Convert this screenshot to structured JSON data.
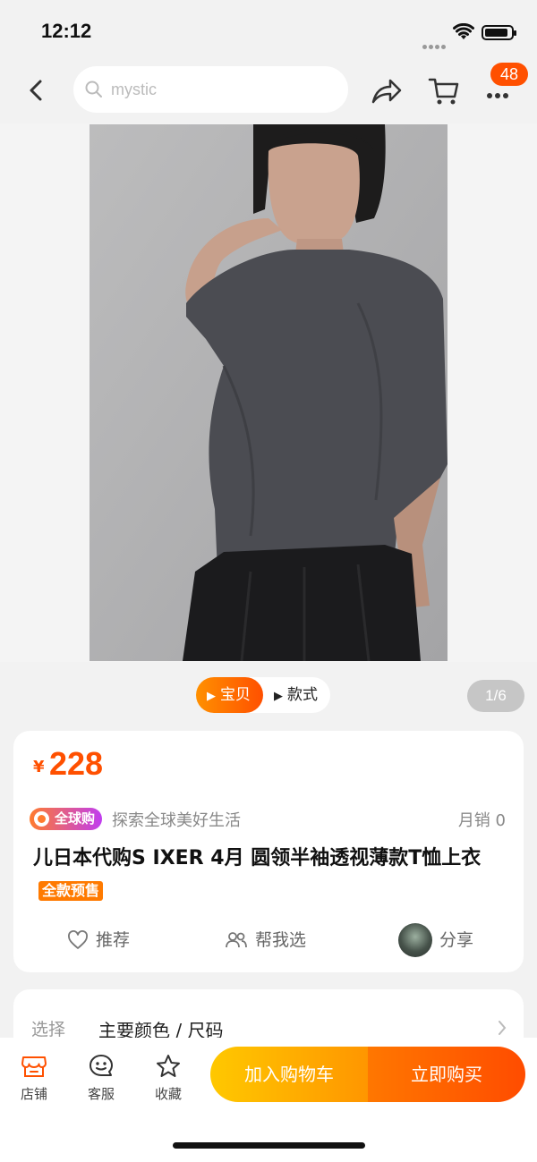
{
  "status": {
    "time": "12:12"
  },
  "nav": {
    "search_text": "mystic",
    "badge_count": "48"
  },
  "gallery": {
    "tabs": [
      {
        "label": "宝贝",
        "active": true
      },
      {
        "label": "款式",
        "active": false
      }
    ],
    "page": "1/6"
  },
  "product": {
    "currency": "¥",
    "price": "228",
    "global_badge": "全球购",
    "tagline": "探索全球美好生活",
    "monthly_sales": "月销  0",
    "title": "儿日本代购S      IXER 4月 圆领半袖透视薄款T恤上衣",
    "presale_tag": "全款预售",
    "actions": {
      "recommend": "推荐",
      "help_choose": "帮我选",
      "share": "分享"
    }
  },
  "options": {
    "label": "选择",
    "value": "主要颜色 / 尺码"
  },
  "bottom_bar": {
    "shop": "店铺",
    "service": "客服",
    "favorite": "收藏",
    "add_to_cart": "加入购物车",
    "buy_now": "立即购买"
  },
  "colors": {
    "accent": "#ff5000",
    "accent_light": "#ff9000",
    "cart_yellow": "#ffc800"
  }
}
